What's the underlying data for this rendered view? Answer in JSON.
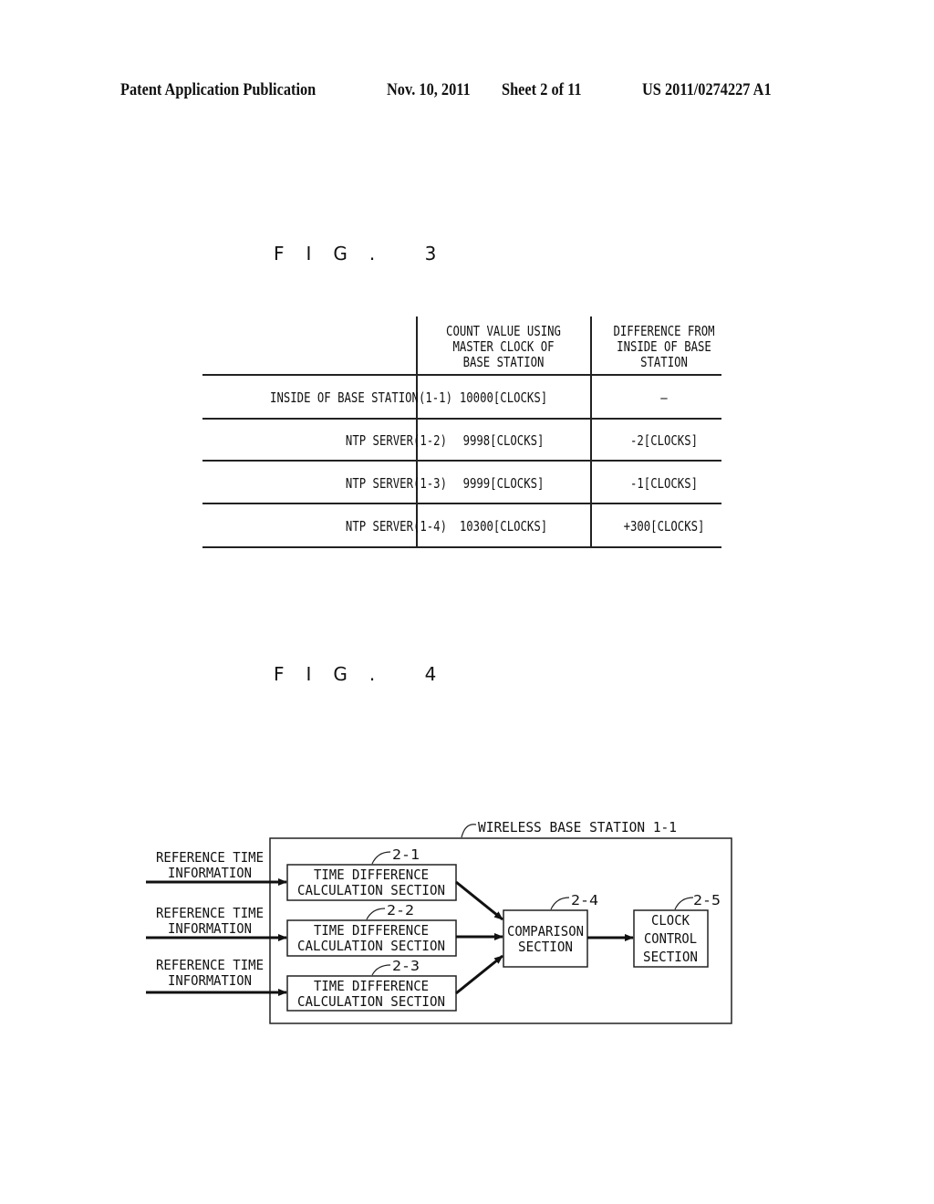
{
  "header": {
    "publication": "Patent Application Publication",
    "date": "Nov. 10, 2011",
    "sheet": "Sheet 2 of 11",
    "number": "US 2011/0274227 A1"
  },
  "fig3": {
    "label": "FIG. 3",
    "columns": [
      "",
      "COUNT VALUE USING MASTER CLOCK OF BASE STATION",
      "DIFFERENCE FROM INSIDE OF BASE STATION"
    ],
    "column_lines": [
      [
        "COUNT VALUE USING",
        "MASTER CLOCK OF",
        "BASE STATION"
      ],
      [
        "DIFFERENCE FROM",
        "INSIDE OF BASE",
        "STATION"
      ]
    ],
    "rows": [
      {
        "source": "INSIDE OF BASE STATION(1-1)",
        "count": "10000[CLOCKS]",
        "difference": "—"
      },
      {
        "source": "NTP SERVER(1-2)",
        "count": "9998[CLOCKS]",
        "difference": "-2[CLOCKS]"
      },
      {
        "source": "NTP SERVER(1-3)",
        "count": "9999[CLOCKS]",
        "difference": "-1[CLOCKS]"
      },
      {
        "source": "NTP SERVER(1-4)",
        "count": "10300[CLOCKS]",
        "difference": "+300[CLOCKS]"
      }
    ]
  },
  "fig4": {
    "label": "FIG. 4",
    "container": {
      "label": "WIRELESS BASE STATION 1-1"
    },
    "inputs": [
      {
        "line1": "REFERENCE TIME",
        "line2": "INFORMATION"
      },
      {
        "line1": "REFERENCE TIME",
        "line2": "INFORMATION"
      },
      {
        "line1": "REFERENCE TIME",
        "line2": "INFORMATION"
      }
    ],
    "calc_blocks": [
      {
        "ref": "2-1",
        "line1": "TIME DIFFERENCE",
        "line2": "CALCULATION SECTION"
      },
      {
        "ref": "2-2",
        "line1": "TIME DIFFERENCE",
        "line2": "CALCULATION SECTION"
      },
      {
        "ref": "2-3",
        "line1": "TIME DIFFERENCE",
        "line2": "CALCULATION SECTION"
      }
    ],
    "comparison": {
      "ref": "2-4",
      "line1": "COMPARISON",
      "line2": "SECTION"
    },
    "clock_control": {
      "ref": "2-5",
      "line1": "CLOCK",
      "line2": "CONTROL",
      "line3": "SECTION"
    }
  }
}
